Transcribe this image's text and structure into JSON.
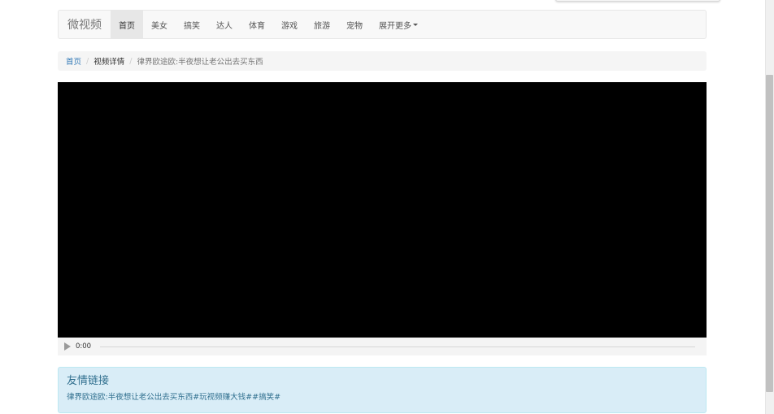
{
  "navbar": {
    "brand": "微视频",
    "items": [
      {
        "label": "首页",
        "active": true
      },
      {
        "label": "美女",
        "active": false
      },
      {
        "label": "搞笑",
        "active": false
      },
      {
        "label": "达人",
        "active": false
      },
      {
        "label": "体育",
        "active": false
      },
      {
        "label": "游戏",
        "active": false
      },
      {
        "label": "旅游",
        "active": false
      },
      {
        "label": "宠物",
        "active": false
      }
    ],
    "more_label": "展开更多"
  },
  "breadcrumb": {
    "home": "首页",
    "separator": "/",
    "section": "视频详情",
    "current": "律界欧途欧:半夜想让老公出去买东西"
  },
  "video": {
    "time": "0:00",
    "progress": 0
  },
  "friend_links": {
    "title": "友情链接",
    "link": "律界欧途欧:半夜想让老公出去买东西#玩视频赚大钱##搞笑#"
  },
  "colors": {
    "link": "#337ab7",
    "panel_bg": "#d9edf7",
    "panel_text": "#31708f",
    "video_bg": "#000000"
  }
}
